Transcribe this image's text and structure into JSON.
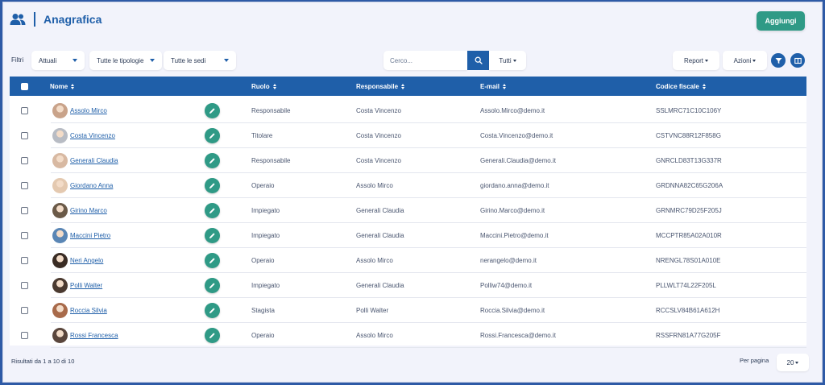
{
  "header": {
    "title": "Anagrafica",
    "icon": "people-icon"
  },
  "toolbar": {
    "add_label": "Aggiungi"
  },
  "filters": {
    "label": "Filtri",
    "status": "Attuali",
    "types": "Tutte le tipologie",
    "sites": "Tutte le sedi",
    "search_placeholder": "Cerco...",
    "scope": "Tutti",
    "report": "Report",
    "actions": "Azioni"
  },
  "table": {
    "columns": [
      "Nome",
      "Ruolo",
      "Responsabile",
      "E-mail",
      "Codice fiscale"
    ],
    "rows": [
      {
        "name": "Assolo Mirco",
        "role": "Responsabile",
        "manager": "Costa Vincenzo",
        "email": "Assolo.Mirco@demo.it",
        "tax_code": "SSLMRC71C10C106Y",
        "avatar_color": "#c9a38a"
      },
      {
        "name": "Costa Vincenzo",
        "role": "Titolare",
        "manager": "Costa Vincenzo",
        "email": "Costa.Vincenzo@demo.it",
        "tax_code": "CSTVNC88R12F858G",
        "avatar_color": "#b8bcc4"
      },
      {
        "name": "Generali Claudia",
        "role": "Responsabile",
        "manager": "Costa Vincenzo",
        "email": "Generali.Claudia@demo.it",
        "tax_code": "GNRCLD83T13G337R",
        "avatar_color": "#d8b9a2"
      },
      {
        "name": "Giordano Anna",
        "role": "Operaio",
        "manager": "Assolo Mirco",
        "email": "giordano.anna@demo.it",
        "tax_code": "GRDNNA82C65G206A",
        "avatar_color": "#e4c9b0"
      },
      {
        "name": "Girino Marco",
        "role": "Impiegato",
        "manager": "Generali Claudia",
        "email": "Girino.Marco@demo.it",
        "tax_code": "GRNMRC79D25F205J",
        "avatar_color": "#6b5a48"
      },
      {
        "name": "Maccini Pietro",
        "role": "Impiegato",
        "manager": "Generali Claudia",
        "email": "Maccini.Pietro@demo.it",
        "tax_code": "MCCPTR85A02A010R",
        "avatar_color": "#5a86b5"
      },
      {
        "name": "Neri Angelo",
        "role": "Operaio",
        "manager": "Assolo Mirco",
        "email": "nerangelo@demo.it",
        "tax_code": "NRENGL78S01A010E",
        "avatar_color": "#3a2c24"
      },
      {
        "name": "Polli Walter",
        "role": "Impiegato",
        "manager": "Generali Claudia",
        "email": "Polliw74@demo.it",
        "tax_code": "PLLWLT74L22F205L",
        "avatar_color": "#4b3a30"
      },
      {
        "name": "Roccia Silvia",
        "role": "Stagista",
        "manager": "Polli Walter",
        "email": "Roccia.Silvia@demo.it",
        "tax_code": "RCCSLV84B61A612H",
        "avatar_color": "#a86a4a"
      },
      {
        "name": "Rossi Francesca",
        "role": "Operaio",
        "manager": "Assolo Mirco",
        "email": "Rossi.Francesca@demo.it",
        "tax_code": "RSSFRN81A77G205F",
        "avatar_color": "#5a463c"
      }
    ]
  },
  "footer": {
    "results": "Risultati da 1 a 10 di 10",
    "per_page_label": "Per pagina",
    "per_page": "20"
  },
  "colors": {
    "primary": "#1f5fa9",
    "accent": "#2f9a86",
    "background": "#f2f3fb"
  }
}
